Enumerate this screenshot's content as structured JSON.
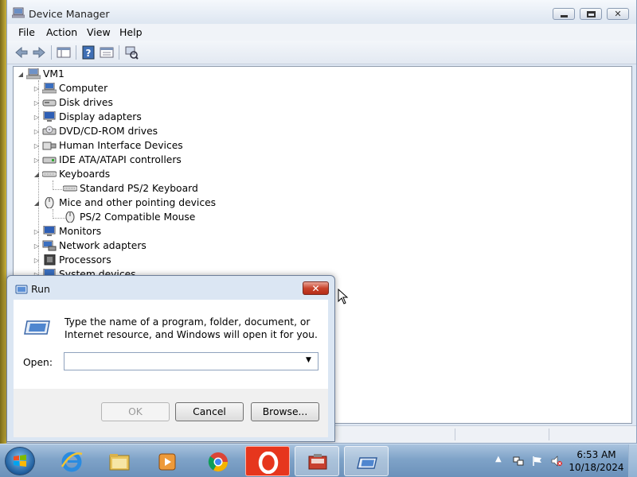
{
  "device_manager": {
    "title": "Device Manager",
    "menu": [
      "File",
      "Action",
      "View",
      "Help"
    ],
    "tree": {
      "root": "VM1",
      "items": [
        {
          "label": "Computer",
          "expanded": false
        },
        {
          "label": "Disk drives",
          "expanded": false
        },
        {
          "label": "Display adapters",
          "expanded": false
        },
        {
          "label": "DVD/CD-ROM drives",
          "expanded": false
        },
        {
          "label": "Human Interface Devices",
          "expanded": false
        },
        {
          "label": "IDE ATA/ATAPI controllers",
          "expanded": false
        },
        {
          "label": "Keyboards",
          "expanded": true,
          "children": [
            "Standard PS/2 Keyboard"
          ]
        },
        {
          "label": "Mice and other pointing devices",
          "expanded": true,
          "children": [
            "PS/2 Compatible Mouse"
          ]
        },
        {
          "label": "Monitors",
          "expanded": false
        },
        {
          "label": "Network adapters",
          "expanded": false
        },
        {
          "label": "Processors",
          "expanded": false
        },
        {
          "label": "System devices",
          "expanded": false
        }
      ]
    }
  },
  "run_dialog": {
    "title": "Run",
    "close_glyph": "✕",
    "description": "Type the name of a program, folder, document, or Internet resource, and Windows will open it for you.",
    "open_label": "Open:",
    "open_value": "",
    "buttons": {
      "ok": "OK",
      "cancel": "Cancel",
      "browse": "Browse..."
    }
  },
  "taskbar": {
    "apps": [
      "internet-explorer",
      "file-explorer",
      "media-player",
      "chrome",
      "opera",
      "device-manager",
      "run"
    ],
    "clock_time": "6:53 AM",
    "clock_date": "10/18/2024"
  }
}
